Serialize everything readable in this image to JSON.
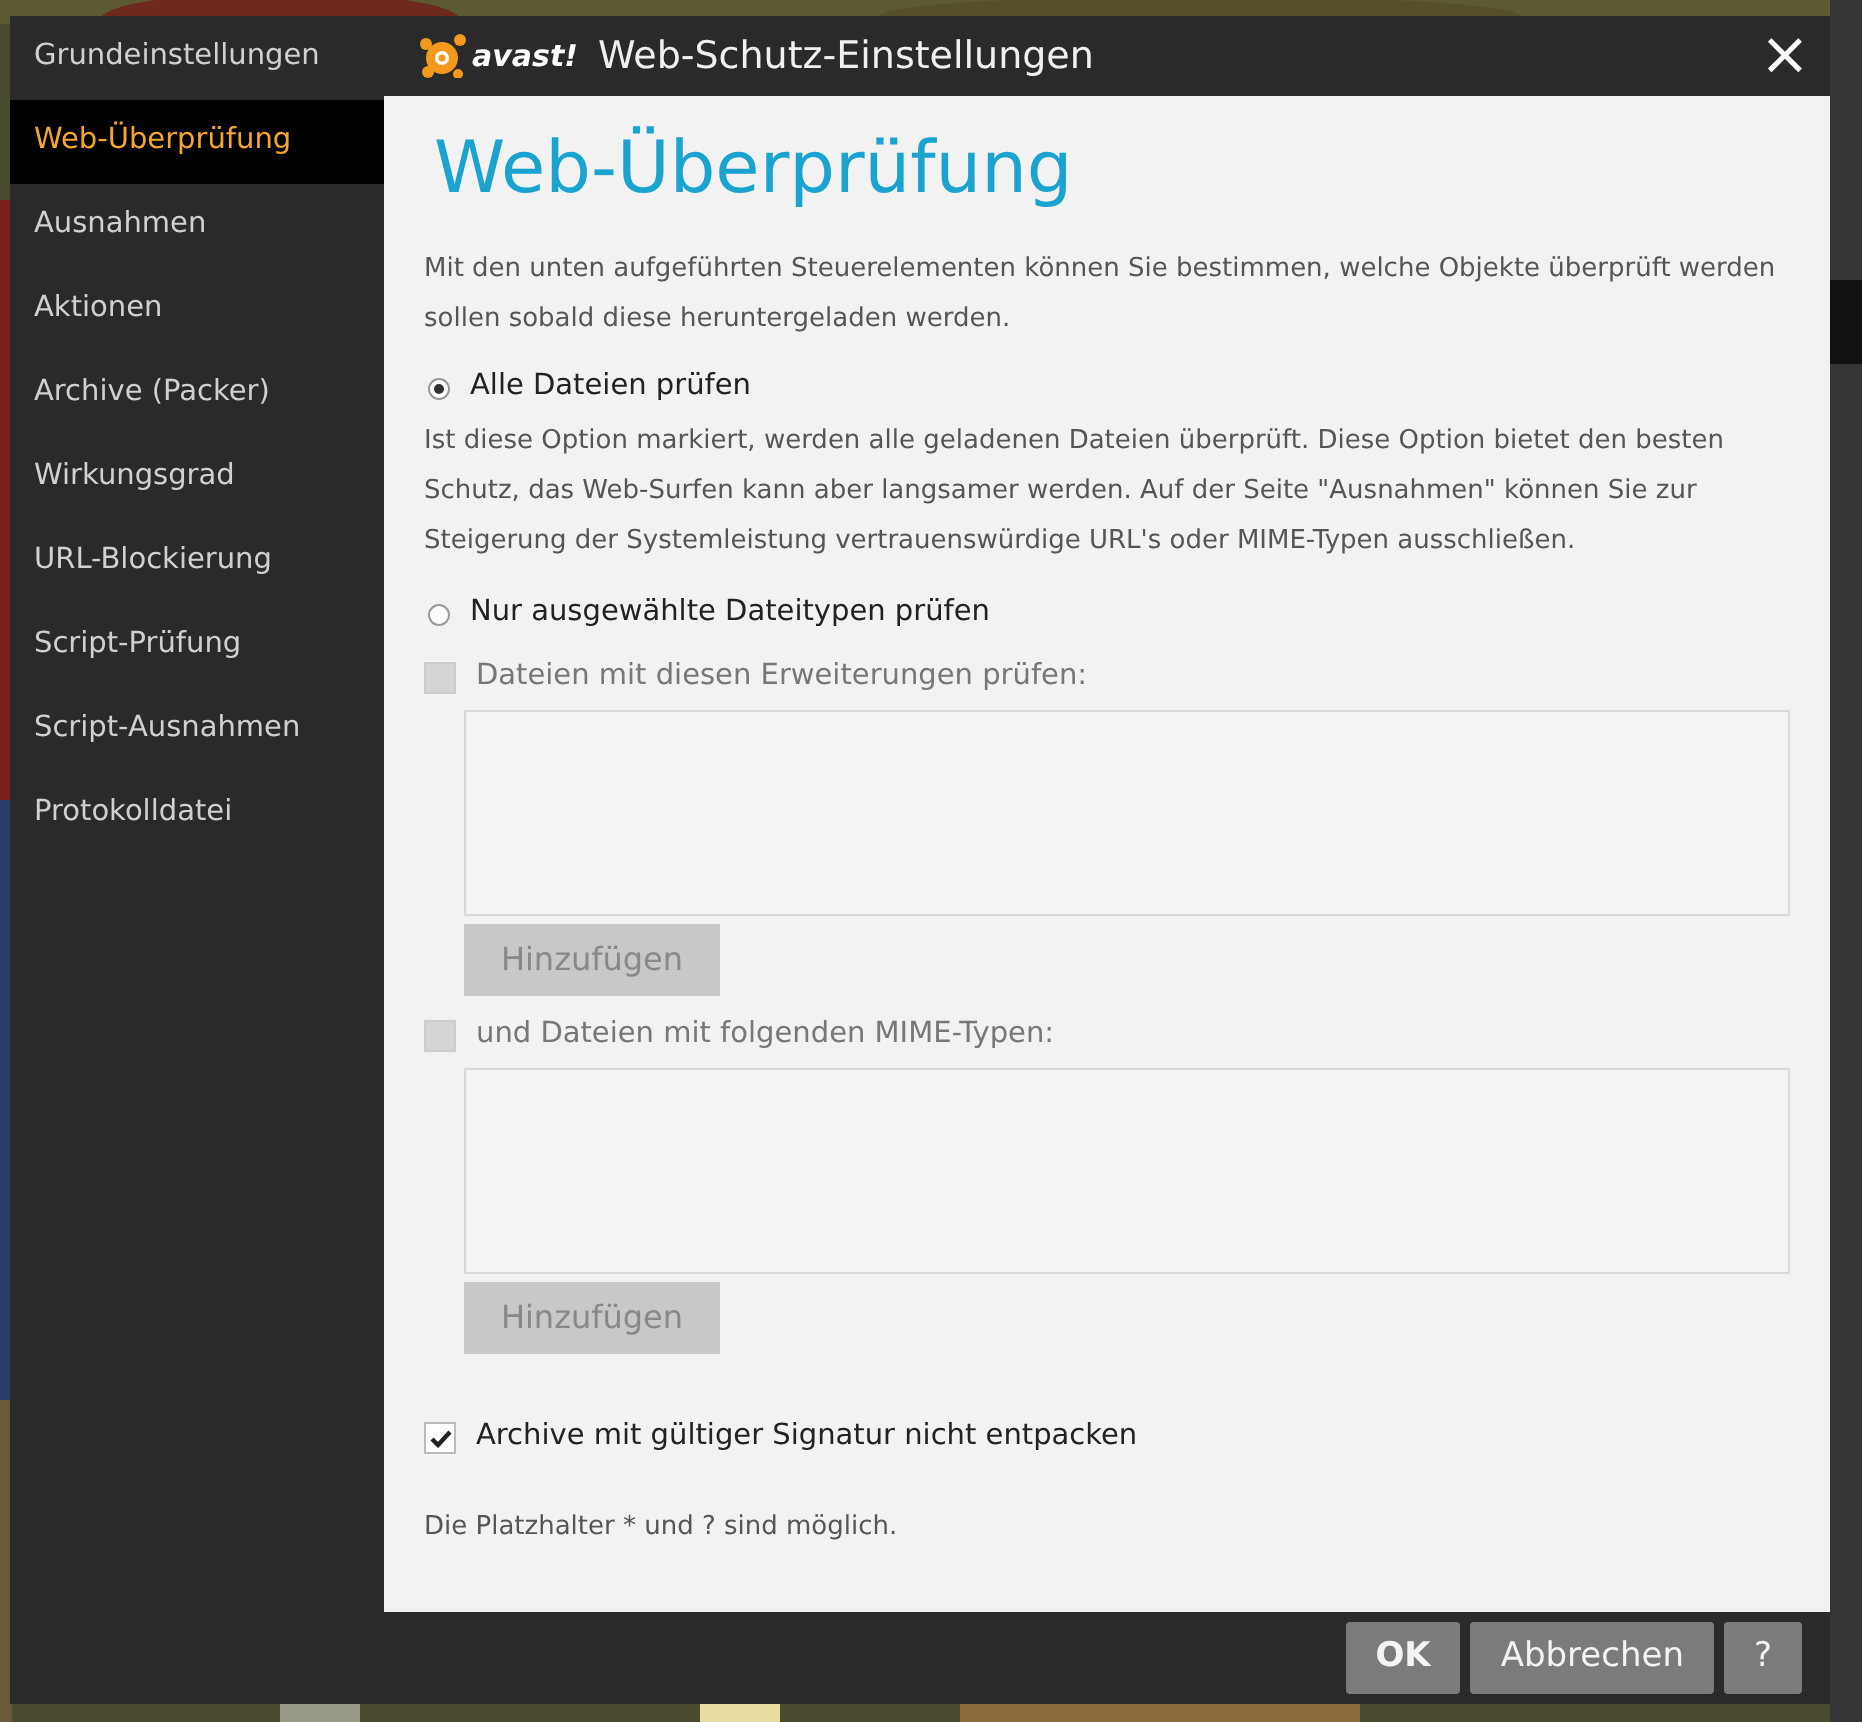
{
  "window": {
    "logo_text": "avast!",
    "title": "Web-Schutz-Einstellungen",
    "close": "×"
  },
  "sidebar": {
    "items": [
      {
        "label": "Grundeinstellungen",
        "selected": false
      },
      {
        "label": "Web-Überprüfung",
        "selected": true
      },
      {
        "label": "Ausnahmen",
        "selected": false
      },
      {
        "label": "Aktionen",
        "selected": false
      },
      {
        "label": "Archive (Packer)",
        "selected": false
      },
      {
        "label": "Wirkungsgrad",
        "selected": false
      },
      {
        "label": "URL-Blockierung",
        "selected": false
      },
      {
        "label": "Script-Prüfung",
        "selected": false
      },
      {
        "label": "Script-Ausnahmen",
        "selected": false
      },
      {
        "label": "Protokolldatei",
        "selected": false
      }
    ]
  },
  "page": {
    "heading": "Web-Überprüfung",
    "intro": "Mit den unten aufgeführten Steuerelementen können Sie bestimmen, welche Objekte überprüft werden sollen sobald diese heruntergeladen werden.",
    "options": [
      {
        "kind": "radio",
        "label": "Alle Dateien prüfen",
        "selected": true,
        "description": "Ist diese Option markiert, werden alle geladenen Dateien überprüft. Diese Option bietet den besten Schutz, das Web-Surfen kann aber langsamer werden. Auf der Seite \"Ausnahmen\" können Sie zur Steigerung der Systemleistung vertrauenswürdige URL's oder MIME-Typen ausschließen."
      },
      {
        "kind": "radio",
        "label": "Nur ausgewählte Dateitypen prüfen",
        "selected": false
      },
      {
        "kind": "checkbox",
        "label": "Dateien mit diesen Erweiterungen prüfen:",
        "checked": false,
        "disabled": true,
        "button": "Hinzufügen"
      },
      {
        "kind": "checkbox",
        "label": "und Dateien mit folgenden MIME-Typen:",
        "checked": false,
        "disabled": true,
        "button": "Hinzufügen"
      },
      {
        "kind": "checkbox",
        "label": "Archive mit gültiger Signatur nicht entpacken",
        "checked": true,
        "disabled": false
      }
    ],
    "note": "Die Platzhalter * und ? sind möglich."
  },
  "footer": {
    "buttons": [
      {
        "label": "OK",
        "default": true
      },
      {
        "label": "Abbrechen",
        "default": false
      },
      {
        "label": "?",
        "default": false
      }
    ]
  }
}
